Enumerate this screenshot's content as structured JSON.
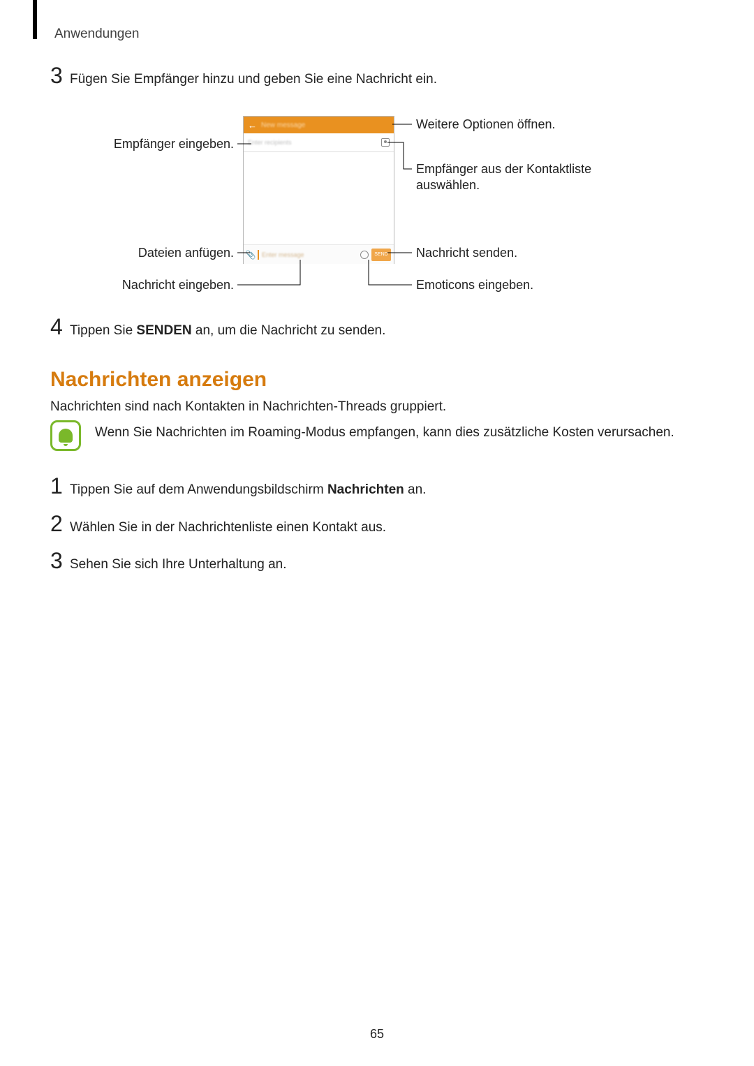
{
  "header": "Anwendungen",
  "step3": {
    "num": "3",
    "text": "Fügen Sie Empfänger hinzu und geben Sie eine Nachricht ein."
  },
  "step4": {
    "num": "4",
    "prefix": "Tippen Sie ",
    "bold": "SENDEN",
    "suffix": " an, um die Nachricht zu senden."
  },
  "callouts": {
    "recip_left": "Empfänger eingeben.",
    "attach_left": "Dateien anfügen.",
    "msg_left": "Nachricht eingeben.",
    "options_right": "Weitere Optionen öffnen.",
    "contacts_right": "Empfänger aus der Kontaktliste auswählen.",
    "send_right": "Nachricht senden.",
    "emoji_right": "Emoticons eingeben."
  },
  "phone_ui": {
    "title": "New message",
    "recipients_ph": "Enter recipients",
    "message_ph": "Enter message",
    "send_label": "SEND"
  },
  "section": {
    "title": "Nachrichten anzeigen",
    "para": "Nachrichten sind nach Kontakten in Nachrichten-Threads gruppiert.",
    "note": "Wenn Sie Nachrichten im Roaming-Modus empfangen, kann dies zusätzliche Kosten verursachen."
  },
  "sub_steps": [
    {
      "num": "1",
      "prefix": "Tippen Sie auf dem Anwendungsbildschirm ",
      "bold": "Nachrichten",
      "suffix": " an."
    },
    {
      "num": "2",
      "prefix": "Wählen Sie in der Nachrichtenliste einen Kontakt aus.",
      "bold": "",
      "suffix": ""
    },
    {
      "num": "3",
      "prefix": "Sehen Sie sich Ihre Unterhaltung an.",
      "bold": "",
      "suffix": ""
    }
  ],
  "page_number": "65"
}
